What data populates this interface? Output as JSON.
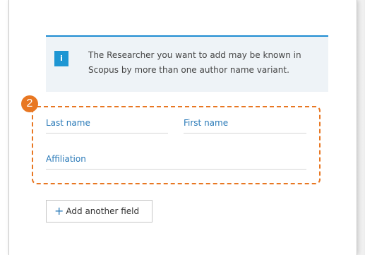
{
  "info": {
    "icon": "info-icon",
    "text_line1": "The Researcher you want to add may be known in",
    "text_line2": "Scopus by more than one author name variant."
  },
  "step_badge": "2",
  "fields": {
    "last_name": "Last name",
    "first_name": "First name",
    "affiliation": "Affiliation"
  },
  "add_button": {
    "icon": "plus-icon",
    "label": "Add another field"
  },
  "colors": {
    "accent_orange": "#e87722",
    "link_blue": "#2a7ab8",
    "info_blue": "#1e96d3",
    "info_bg": "#eef3f7"
  }
}
